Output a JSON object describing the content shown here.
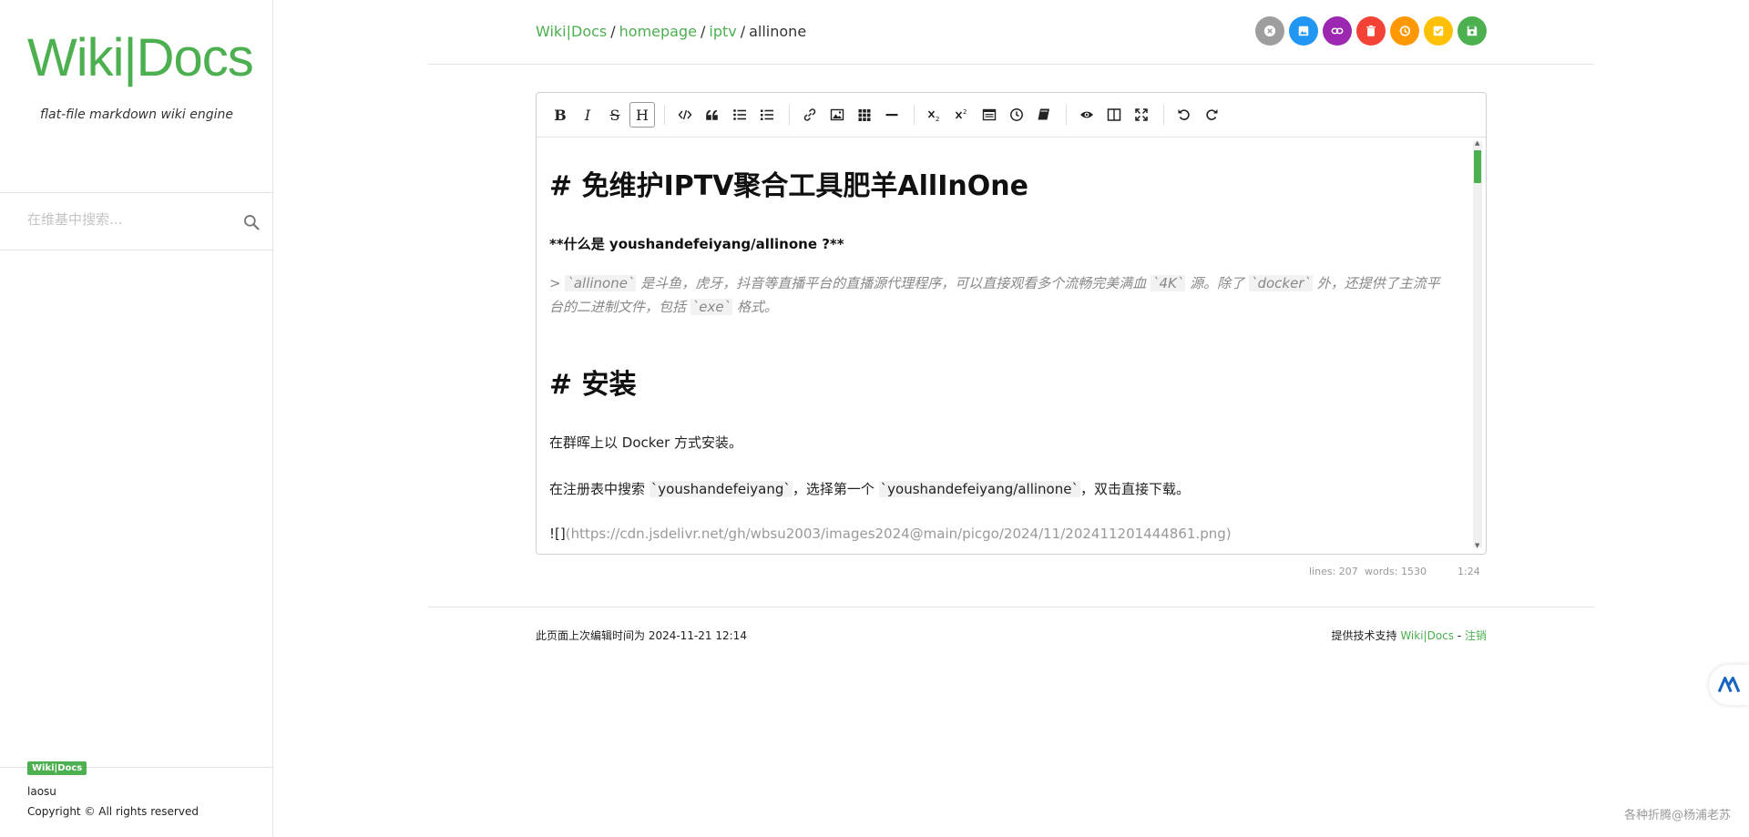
{
  "sidebar": {
    "logo": "Wiki|Docs",
    "tagline": "flat-file markdown wiki engine",
    "search_placeholder": "在维基中搜索...",
    "badge": "Wiki|Docs",
    "user": "laosu",
    "copyright": "Copyright © All rights reserved"
  },
  "breadcrumb": {
    "root": "Wiki|Docs",
    "items": [
      "homepage",
      "iptv"
    ],
    "current": "allinone",
    "sep": "/"
  },
  "actions": [
    {
      "name": "cancel",
      "color": "#9e9e9e"
    },
    {
      "name": "image",
      "color": "#2196f3"
    },
    {
      "name": "link",
      "color": "#9c27b0"
    },
    {
      "name": "delete",
      "color": "#f44336"
    },
    {
      "name": "history",
      "color": "#ff9800"
    },
    {
      "name": "draft",
      "color": "#ffc107"
    },
    {
      "name": "save",
      "color": "#4caf50"
    }
  ],
  "editor": {
    "h1_a": "# 免维护IPTV聚合工具肥羊AllInOne",
    "bold_line": "**什么是 youshandefeiyang/allinone ?**",
    "quote_a1": "> ",
    "quote_code1": "`allinone`",
    "quote_a2": " 是斗鱼，虎牙，抖音等直播平台的直播源代理程序，可以直接观看多个流畅完美满血 ",
    "quote_code2": "`4K`",
    "quote_a3": " 源。除了 ",
    "quote_code3": "`docker`",
    "quote_a4": " 外，还提供了主流平",
    "quote_b1": "台的二进制文件，包括 ",
    "quote_code4": "`exe`",
    "quote_b2": " 格式。",
    "h1_b": "# 安装",
    "para1": "在群晖上以 Docker 方式安装。",
    "para2_a": "在注册表中搜索 ",
    "para2_code1": "`youshandefeiyang`",
    "para2_b": "，选择第一个 ",
    "para2_code2": "`youshandefeiyang/allinone`",
    "para2_c": "，双击直接下载。",
    "link_prefix": "![]",
    "link_url": "(https://cdn.jsdelivr.net/gh/wbsu2003/images2024@main/picgo/2024/11/202411201444861.png)"
  },
  "status": {
    "lines": "lines: 207",
    "words": "words: 1530",
    "cursor": "1:24"
  },
  "footer": {
    "last_edit": "此页面上次编辑时间为 2024-11-21 12:14",
    "powered_prefix": "提供技术支持 ",
    "powered_link": "Wiki|Docs",
    "dash": " - ",
    "logout": "注销"
  },
  "watermark": "各种折腾@杨浦老苏"
}
